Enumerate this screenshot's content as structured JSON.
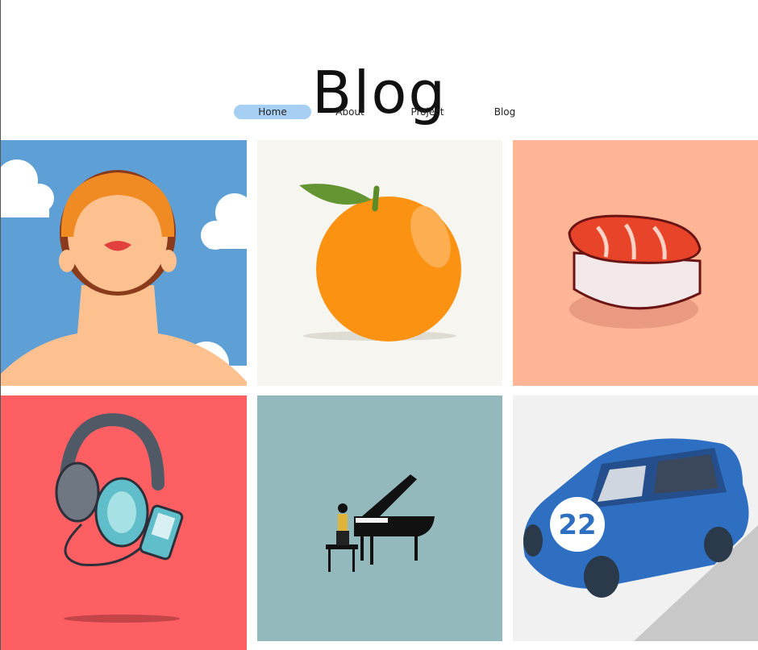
{
  "header": {
    "title": "Blog"
  },
  "nav": {
    "items": [
      {
        "label": "Home",
        "active": true
      },
      {
        "label": "About",
        "active": false
      },
      {
        "label": "Project",
        "active": false
      },
      {
        "label": "Blog",
        "active": false
      }
    ],
    "active_color": "#a7cff3"
  },
  "gallery": {
    "tiles": [
      {
        "subject": "woman-face-illustration",
        "bg": "#5e9fd6"
      },
      {
        "subject": "orange-fruit-illustration",
        "bg": "#f7f5f0"
      },
      {
        "subject": "salmon-sushi-illustration",
        "bg": "#fdb595"
      },
      {
        "subject": "headphones-music-player-illustration",
        "bg": "#fd5f63"
      },
      {
        "subject": "grand-piano-illustration",
        "bg": "#93b9bd"
      },
      {
        "subject": "blue-car-illustration",
        "bg": "#f1f1f1"
      }
    ]
  },
  "car_number": "22"
}
